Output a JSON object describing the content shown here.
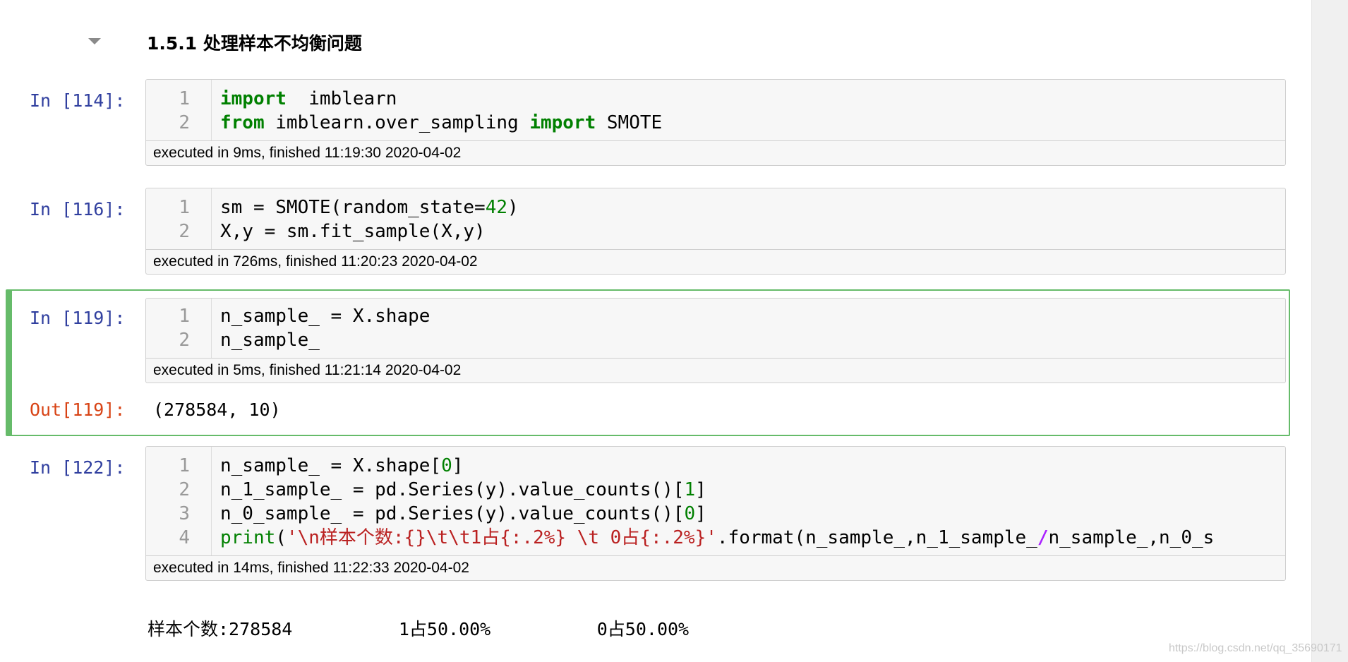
{
  "heading": {
    "number": "1.5.1",
    "title": "处理样本不均衡问题"
  },
  "cells": [
    {
      "prompt": "In [114]:",
      "lines": [
        {
          "n": "1",
          "tokens": [
            [
              "kw",
              "import"
            ],
            [
              "",
              "  imblearn"
            ]
          ]
        },
        {
          "n": "2",
          "tokens": [
            [
              "kw",
              "from"
            ],
            [
              "",
              " imblearn.over_sampling "
            ],
            [
              "kw",
              "import"
            ],
            [
              "",
              " SMOTE"
            ]
          ]
        }
      ],
      "status": "executed in 9ms, finished 11:19:30 2020-04-02"
    },
    {
      "prompt": "In [116]:",
      "lines": [
        {
          "n": "1",
          "tokens": [
            [
              "",
              "sm = SMOTE(random_state="
            ],
            [
              "num",
              "42"
            ],
            [
              "",
              ")"
            ]
          ]
        },
        {
          "n": "2",
          "tokens": [
            [
              "",
              "X,y = sm.fit_sample(X,y)"
            ]
          ]
        }
      ],
      "status": "executed in 726ms, finished 11:20:23 2020-04-02"
    },
    {
      "prompt": "In [119]:",
      "lines": [
        {
          "n": "1",
          "tokens": [
            [
              "",
              "n_sample_ = X.shape"
            ]
          ]
        },
        {
          "n": "2",
          "tokens": [
            [
              "",
              "n_sample_"
            ]
          ]
        }
      ],
      "status": "executed in 5ms, finished 11:21:14 2020-04-02",
      "out_prompt": "Out[119]:",
      "output": "(278584, 10)"
    },
    {
      "prompt": "In [122]:",
      "lines": [
        {
          "n": "1",
          "tokens": [
            [
              "",
              "n_sample_ = X.shape["
            ],
            [
              "num",
              "0"
            ],
            [
              "",
              "]"
            ]
          ]
        },
        {
          "n": "2",
          "tokens": [
            [
              "",
              "n_1_sample_ = pd.Series(y).value_counts()["
            ],
            [
              "num",
              "1"
            ],
            [
              "",
              "]"
            ]
          ]
        },
        {
          "n": "3",
          "tokens": [
            [
              "",
              "n_0_sample_ = pd.Series(y).value_counts()["
            ],
            [
              "num",
              "0"
            ],
            [
              "",
              "]"
            ]
          ]
        },
        {
          "n": "4",
          "tokens": [
            [
              "fn",
              "print"
            ],
            [
              "",
              "("
            ],
            [
              "str",
              "'\\n样本个数:{}\\t\\t1占{:.2%} \\t 0占{:.2%}'"
            ],
            [
              "",
              ".format(n_sample_,n_1_sample_"
            ],
            [
              "op",
              "/"
            ],
            [
              "",
              "n_sample_,n_0_s"
            ]
          ]
        }
      ],
      "status": "executed in 14ms, finished 11:22:33 2020-04-02",
      "stdout": "样本个数:278584          1占50.00%          0占50.00%"
    }
  ],
  "watermark": "https://blog.csdn.net/qq_35690171"
}
